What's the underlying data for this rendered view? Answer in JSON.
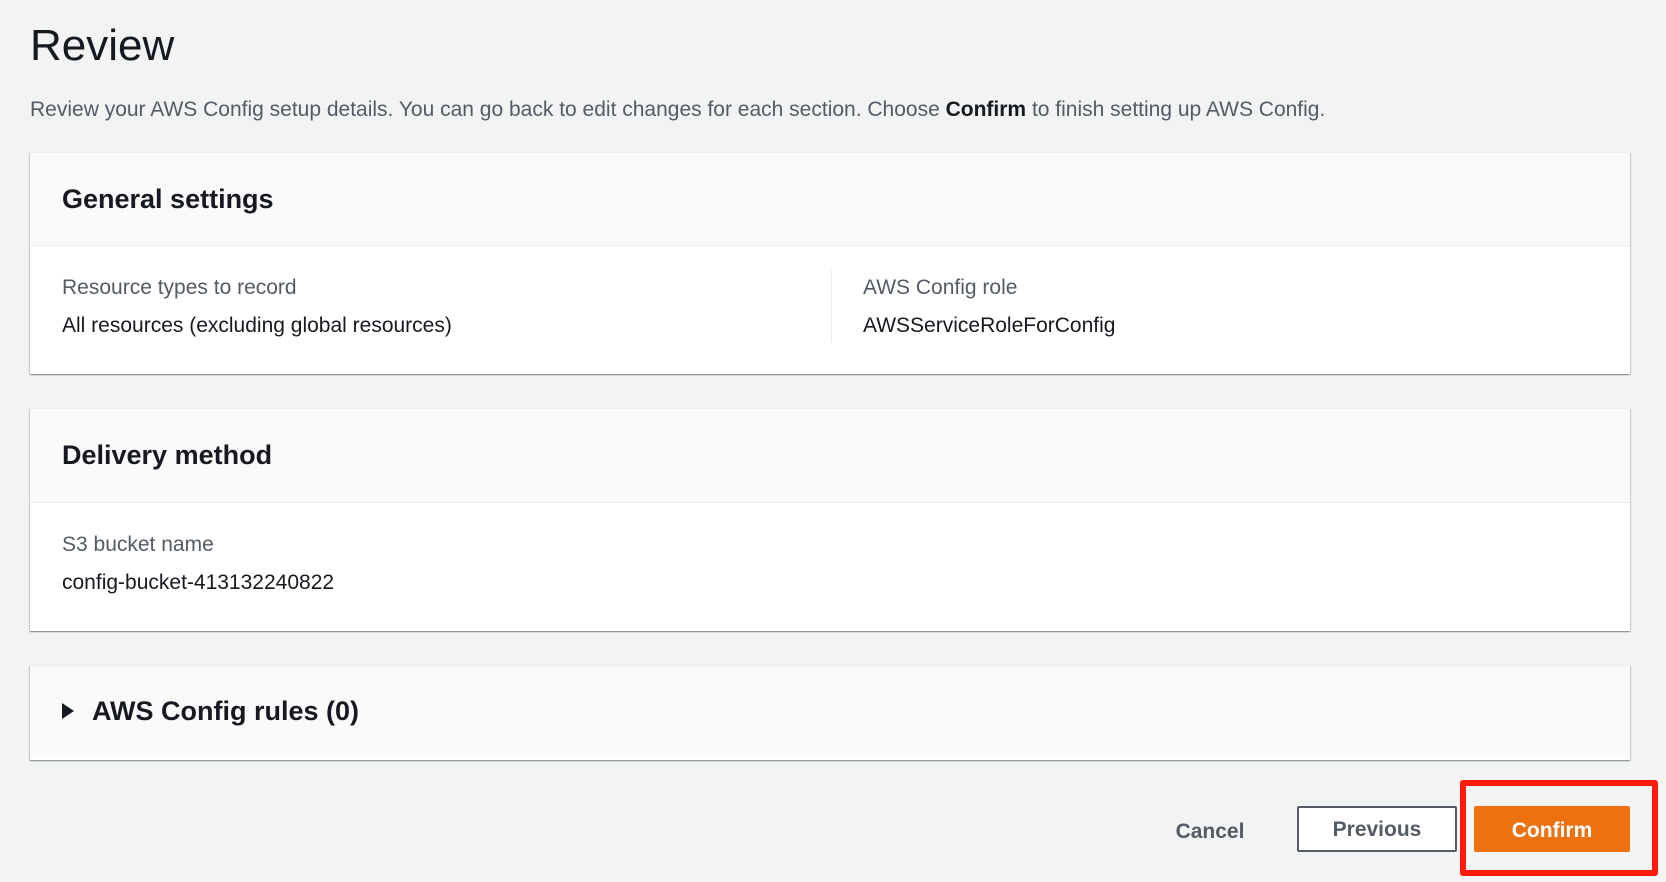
{
  "page": {
    "title": "Review",
    "description_before": "Review your AWS Config setup details. You can go back to edit changes for each section. Choose ",
    "description_bold": "Confirm",
    "description_after": " to finish setting up AWS Config."
  },
  "general_settings": {
    "heading": "General settings",
    "resource_types_label": "Resource types to record",
    "resource_types_value": "All resources (excluding global resources)",
    "config_role_label": "AWS Config role",
    "config_role_value": "AWSServiceRoleForConfig"
  },
  "delivery_method": {
    "heading": "Delivery method",
    "s3_bucket_label": "S3 bucket name",
    "s3_bucket_value": "config-bucket-413132240822"
  },
  "config_rules": {
    "heading": "AWS Config rules (0)",
    "expanded": false
  },
  "actions": {
    "cancel_label": "Cancel",
    "previous_label": "Previous",
    "confirm_label": "Confirm"
  },
  "colors": {
    "primary": "#ec7211",
    "highlight": "#ff1a0a",
    "background": "#f2f3f3"
  }
}
